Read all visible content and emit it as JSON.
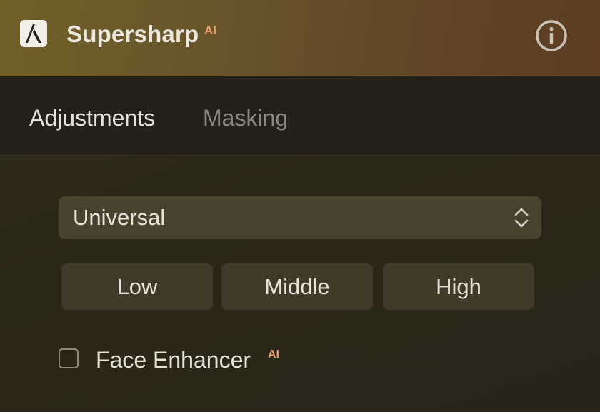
{
  "header": {
    "title": "Supersharp",
    "title_badge": "AI",
    "logo_icon": "supersharp-logo-icon",
    "info_icon": "info-icon"
  },
  "tabs": [
    {
      "label": "Adjustments",
      "active": true
    },
    {
      "label": "Masking",
      "active": false
    }
  ],
  "model_select": {
    "value": "Universal",
    "icon": "chevron-updown-icon"
  },
  "strength_buttons": [
    {
      "label": "Low"
    },
    {
      "label": "Middle"
    },
    {
      "label": "High"
    }
  ],
  "face_enhancer": {
    "label": "Face Enhancer",
    "badge": "AI",
    "checked": false
  },
  "colors": {
    "header_gradient_start": "#6f6128",
    "header_gradient_end": "#5e3d22",
    "ai_badge": "#f0a070",
    "panel_bg": "#2b2718",
    "control_bg": "#48432f",
    "button_bg": "#403b29"
  }
}
